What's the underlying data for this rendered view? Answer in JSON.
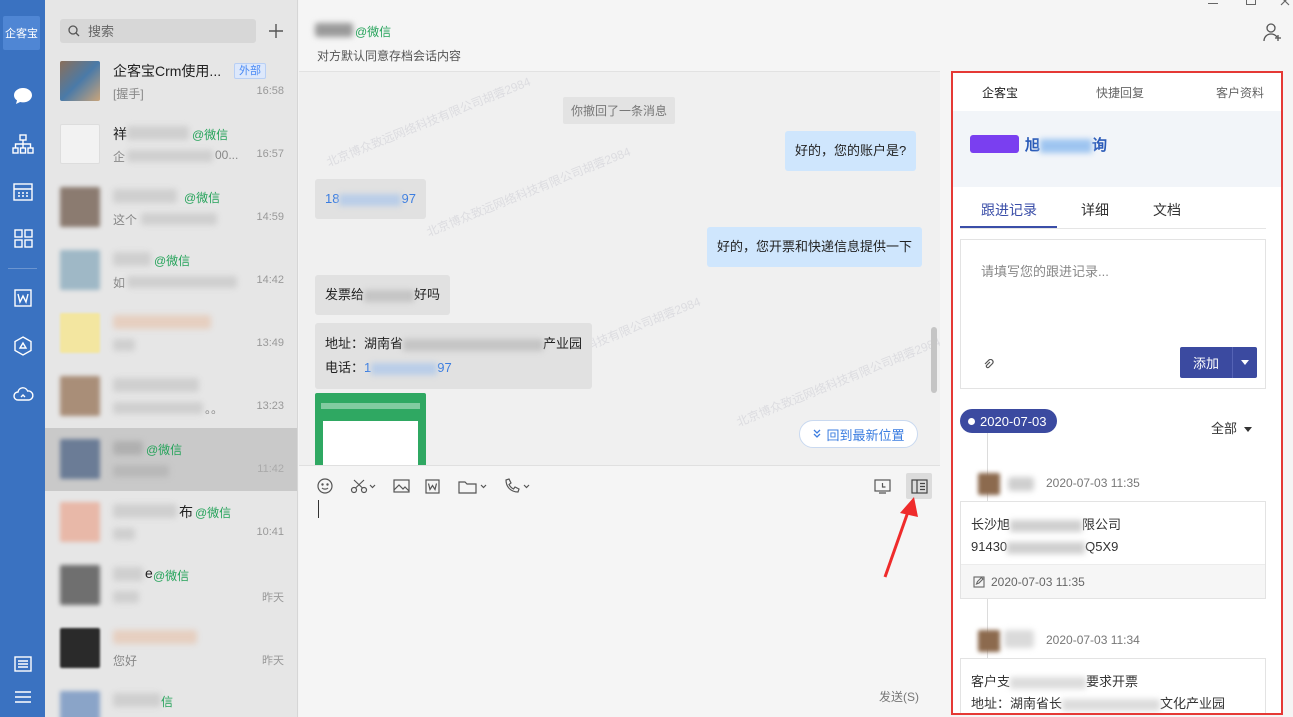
{
  "nav": {
    "logo": "企客宝",
    "icons": [
      "chat-icon",
      "org-icon",
      "calendar-icon",
      "apps-icon",
      "word-icon",
      "cube-icon",
      "cloud-icon",
      "settings-icon",
      "menu-icon"
    ]
  },
  "session_list": {
    "search_placeholder": "搜索",
    "sessions": [
      {
        "name": "企客宝Crm使用...",
        "tag": "外部",
        "snippet": "[握手]",
        "time": "16:58"
      },
      {
        "name": "祥",
        "wx": "@微信",
        "snippet": "企",
        "snippet_suffix": "00...",
        "time": "16:57"
      },
      {
        "name": "",
        "wx": "@微信",
        "snippet": "这个",
        "time": "14:59"
      },
      {
        "name": "",
        "wx": "@微信",
        "snippet": "如",
        "time": "14:42"
      },
      {
        "name": "",
        "wx": "",
        "snippet": "",
        "time": "13:49"
      },
      {
        "name": "",
        "wx": "",
        "snippet": "。。",
        "time": "13:23"
      },
      {
        "name": "",
        "wx": "@微信",
        "snippet": "",
        "time": "11:42"
      },
      {
        "name": "布",
        "wx": "@微信",
        "snippet": "",
        "time": "10:41"
      },
      {
        "name": "e",
        "wx": "@微信",
        "snippet": "",
        "time": "昨天"
      },
      {
        "name": "",
        "wx": "",
        "snippet": "您好",
        "time": "昨天"
      },
      {
        "name": "",
        "wx": "信",
        "snippet": "",
        "time": ""
      }
    ]
  },
  "chat": {
    "contact_suffix": "@微信",
    "subtitle": "对方默认同意存档会话内容",
    "system_msg": "你撤回了一条消息",
    "messages": {
      "m1": "好的，您的账户是?",
      "m2_prefix": "18",
      "m2_suffix": "97",
      "m3": "好的，您开票和快递信息提供一下",
      "m4_prefix": "发票给",
      "m4_suffix": "好吗",
      "m5_line1_prefix": "地址：湖南省",
      "m5_line1_suffix": "产业园",
      "m5_line2_prefix": "电话：",
      "m5_line2_link": "1",
      "m5_line2_link_suffix": "97"
    },
    "latest_btn": "回到最新位置",
    "send_label": "发送(S)"
  },
  "right_panel": {
    "tabs": [
      "企客宝",
      "快捷回复",
      "客户资料"
    ],
    "customer_name_prefix": "旭",
    "customer_name_suffix": "询",
    "sub_tabs": [
      "跟进记录",
      "详细",
      "文档"
    ],
    "follow_placeholder": "请填写您的跟进记录...",
    "add_label": "添加",
    "date_pill": "2020-07-03",
    "filter_label": "全部",
    "entries": [
      {
        "time": "2020-07-03 11:35",
        "line1_prefix": "长沙旭",
        "line1_suffix": "限公司",
        "line2_prefix": "91430",
        "line2_suffix": "Q5X9",
        "foot_time": "2020-07-03 11:35"
      },
      {
        "time": "2020-07-03 11:34",
        "line1_prefix": "客户支",
        "line1_suffix": "要求开票",
        "line2_prefix": "地址：湖南省长",
        "line2_suffix": "文化产业园"
      }
    ]
  },
  "colors": {
    "nav": "#3a72c1",
    "accent": "#3b4aa0",
    "highlight_box": "#e53935",
    "wechat_green": "#25a35a"
  }
}
